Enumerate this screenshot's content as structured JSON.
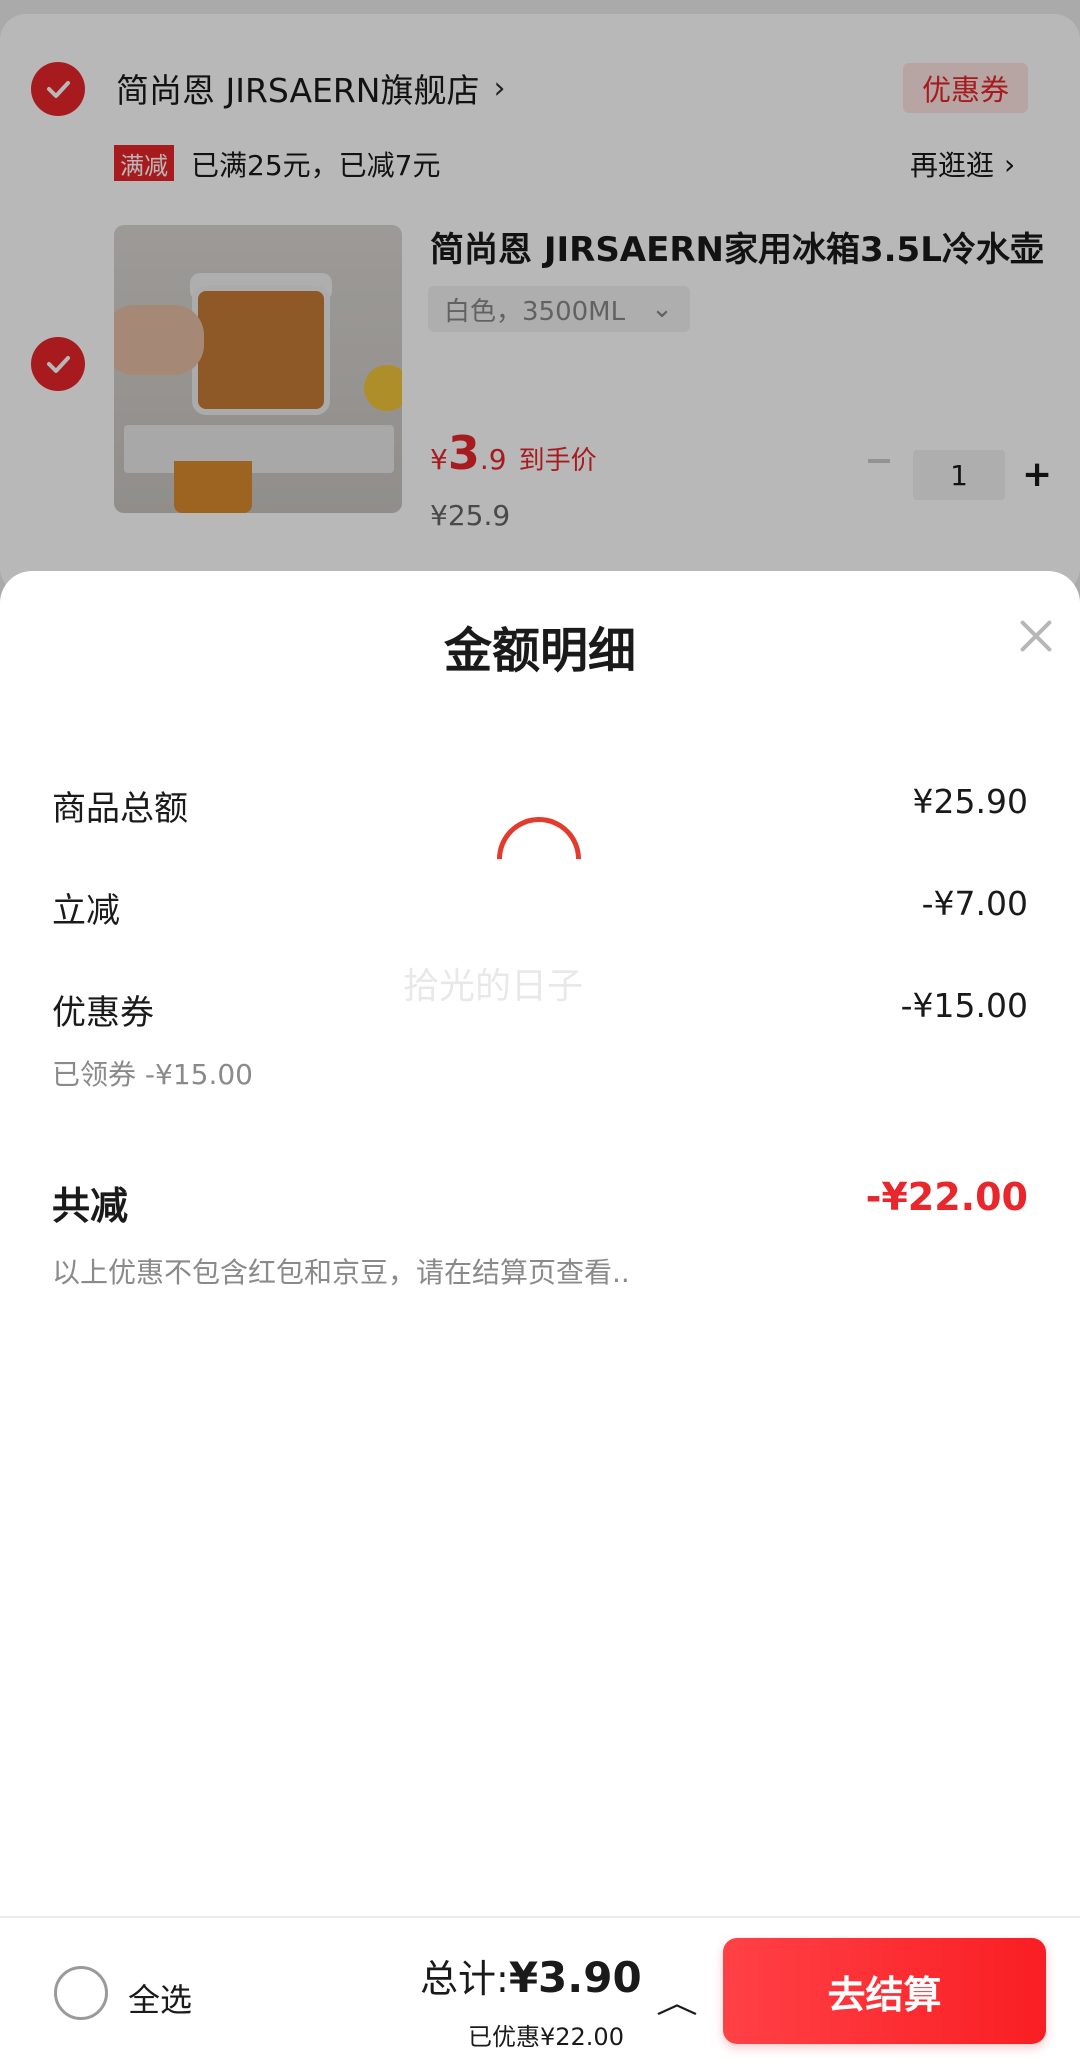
{
  "cart": {
    "shop_name": "简尚恩 JIRSAERN旗舰店",
    "coupon_button": "优惠券",
    "promo_tag": "满减",
    "promo_text": "已满25元，已减7元",
    "promo_more": "再逛逛",
    "product": {
      "title": "简尚恩 JIRSAERN家用冰箱3.5L冷水壶",
      "sku": "白色，3500ML",
      "price_symbol": "¥",
      "price_int": "3",
      "price_dec": ".9",
      "price_tag": "到手价",
      "original_price": "¥25.9",
      "quantity": "1",
      "plus": "+"
    }
  },
  "sheet": {
    "title": "金额明细",
    "rows": [
      {
        "label": "商品总额",
        "value": "¥25.90"
      },
      {
        "label": "立减",
        "value": "-¥7.00"
      },
      {
        "label": "优惠券",
        "value": "-¥15.00",
        "sub": "已领券 -¥15.00"
      }
    ],
    "total_label": "共减",
    "total_value": "-¥22.00",
    "note": "以上优惠不包含红包和京豆，请在结算页查看..",
    "watermark": "拾光的日子"
  },
  "bottom": {
    "select_all": "全选",
    "total_label": "总计:",
    "total_amount": "¥3.90",
    "saved": "已优惠¥22.00",
    "checkout": "去结算"
  },
  "colors": {
    "accent": "#e8262c",
    "muted_text": "#8a8a8a"
  },
  "icons": [
    "check-icon",
    "chevron-right-icon",
    "chevron-down-icon",
    "close-icon",
    "loading-spinner-icon",
    "chevron-up-icon",
    "radio-unchecked-icon"
  ]
}
